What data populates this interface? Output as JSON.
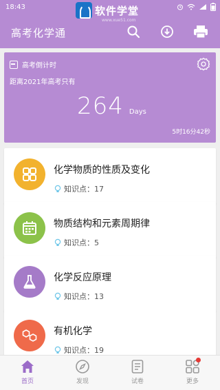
{
  "status": {
    "time": "18:43"
  },
  "watermark": {
    "text": "软件学堂",
    "sub": "www.xue51.com"
  },
  "app": {
    "title": "高考化学通"
  },
  "countdown": {
    "header": "高考倒计时",
    "subtitle": "距离2021年高考只有",
    "days": "264",
    "unit": "Days",
    "remaining": "5时16分42秒"
  },
  "cards": [
    {
      "title": "化学物质的性质及变化",
      "meta": "知识点：17",
      "color": "#f2b22e",
      "icon": "grid-icon"
    },
    {
      "title": "物质结构和元素周期律",
      "meta": "知识点：5",
      "color": "#8cc24a",
      "icon": "calendar-icon"
    },
    {
      "title": "化学反应原理",
      "meta": "知识点：13",
      "color": "#a57bc8",
      "icon": "flask-icon"
    },
    {
      "title": "有机化学",
      "meta": "知识点：19",
      "color": "#ef6a4a",
      "icon": "molecule-icon"
    }
  ],
  "nav": [
    {
      "label": "首页",
      "icon": "home-icon",
      "active": true
    },
    {
      "label": "发现",
      "icon": "compass-icon",
      "active": false
    },
    {
      "label": "试卷",
      "icon": "paper-icon",
      "active": false
    },
    {
      "label": "更多",
      "icon": "apps-icon",
      "active": false
    }
  ],
  "colors": {
    "primary": "#b68bd3",
    "accent": "#9b6cc8",
    "badge": "#e53935"
  }
}
